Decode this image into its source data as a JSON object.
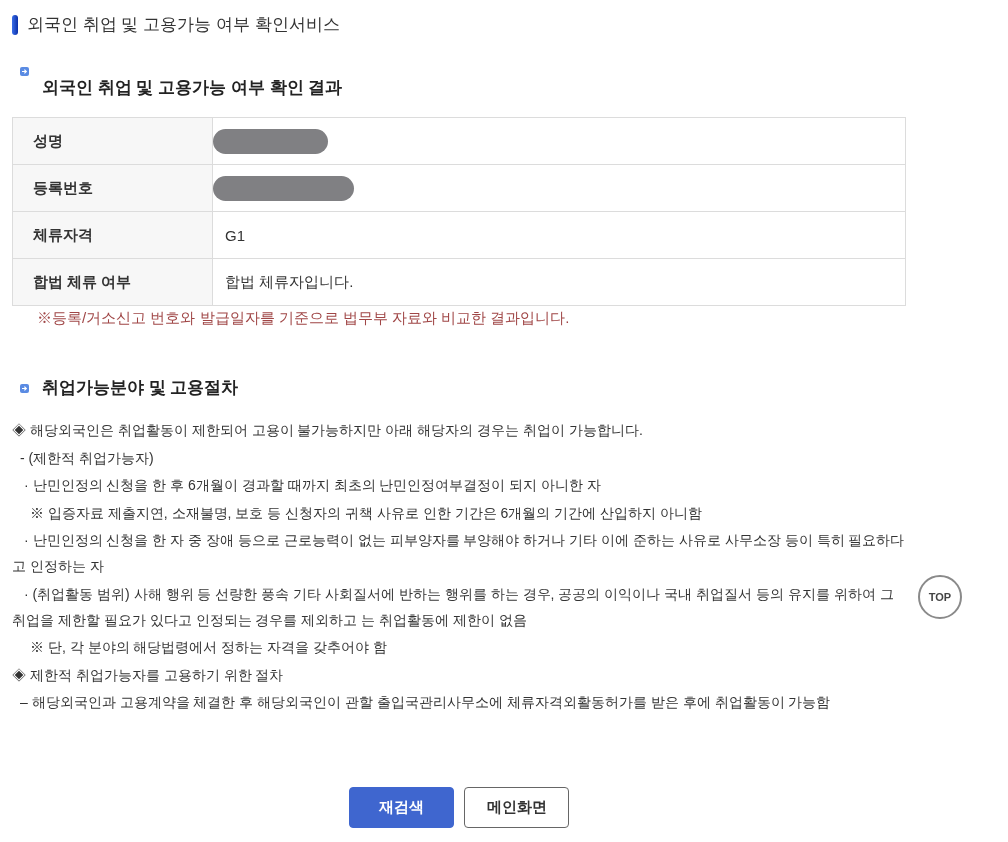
{
  "page_title": "외국인 취업 및 고용가능 여부 확인서비스",
  "result": {
    "heading": "외국인 취업 및 고용가능 여부 확인 결과",
    "rows": [
      {
        "label": "성명",
        "redacted": true
      },
      {
        "label": "등록번호",
        "redacted": true
      },
      {
        "label": "체류자격",
        "value": "G1",
        "redacted": false
      },
      {
        "label": "합법 체류 여부",
        "value": "합법 체류자입니다.",
        "redacted": false
      }
    ],
    "note": "※등록/거소신고 번호와 발급일자를 기준으로 법무부 자료와 비교한 결과입니다."
  },
  "employment": {
    "heading": "취업가능분야 및 고용절차",
    "items": [
      {
        "text": "◈ 해당외국인은 취업활동이 제한되어 고용이 불가능하지만 아래 해당자의 경우는 취업이 가능합니다.",
        "children": [
          {
            "text": "- (제한적 취업가능자)",
            "children": [
              {
                "text": "· 난민인정의 신청을 한 후 6개월이 경과할 때까지 최초의 난민인정여부결정이 되지 아니한 자",
                "children": [
                  {
                    "text": "※ 입증자료 제출지연, 소재불명, 보호 등 신청자의 귀책 사유로 인한 기간은 6개월의 기간에 산입하지 아니함"
                  }
                ]
              },
              {
                "text": "· 난민인정의 신청을 한 자 중 장애 등으로 근로능력이 없는 피부양자를 부양해야 하거나 기타 이에 준하는 사유로 사무소장 등이 특히 필요하다고 인정하는 자"
              },
              {
                "text": "· (취업활동 범위) 사해 행위 등 선량한 풍속 기타 사회질서에 반하는 행위를 하는 경우, 공공의 이익이나 국내 취업질서 등의 유지를 위하여 그 취업을 제한할 필요가 있다고 인정되는 경우를 제외하고 는 취업활동에 제한이 없음",
                "children": [
                  {
                    "text": "※ 단, 각 분야의 해당법령에서 정하는 자격을 갖추어야 함"
                  }
                ]
              }
            ]
          }
        ]
      },
      {
        "text": "◈ 제한적 취업가능자를 고용하기 위한 절차",
        "children": [
          {
            "text": "– 해당외국인과 고용계약을 체결한 후 해당외국인이 관할 출입국관리사무소에 체류자격외활동허가를 받은 후에 취업활동이 가능함"
          }
        ]
      }
    ]
  },
  "buttons": [
    {
      "label": "재검색",
      "kind": "primary"
    },
    {
      "label": "메인화면",
      "kind": "secondary"
    }
  ],
  "top_button": "TOP"
}
